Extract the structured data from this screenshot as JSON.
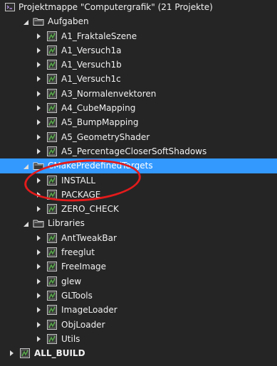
{
  "solution": {
    "label": "Projektmappe \"Computergrafik\" (21 Projekte)",
    "icon": "solution-icon"
  },
  "folders": [
    {
      "label": "Aufgaben",
      "icon": "folder-icon",
      "expanded": true,
      "projects": [
        "A1_FraktaleSzene",
        "A1_Versuch1a",
        "A1_Versuch1b",
        "A1_Versuch1c",
        "A3_Normalenvektoren",
        "A4_CubeMapping",
        "A5_BumpMapping",
        "A5_GeometryShader",
        "A5_PercentageCloserSoftShadows"
      ]
    },
    {
      "label": "CMakePredefinedTargets",
      "icon": "folder-icon",
      "expanded": true,
      "selected": true,
      "projects": [
        "INSTALL",
        "PACKAGE",
        "ZERO_CHECK"
      ]
    },
    {
      "label": "Libraries",
      "icon": "folder-icon",
      "expanded": true,
      "projects": [
        "AntTweakBar",
        "freeglut",
        "FreeImage",
        "glew",
        "GLTools",
        "ImageLoader",
        "ObjLoader",
        "Utils"
      ]
    }
  ],
  "root_project": {
    "label": "ALL_BUILD",
    "bold": true
  },
  "annotation": {
    "color": "#e31b1b",
    "shape": "ellipse"
  },
  "colors": {
    "background": "#252526",
    "selection": "#3399ff",
    "text": "#f1f1f1"
  }
}
